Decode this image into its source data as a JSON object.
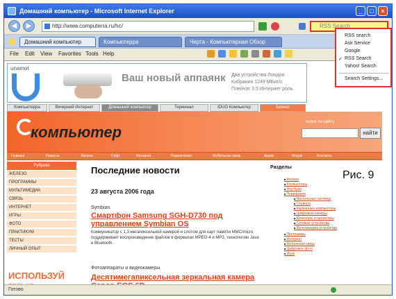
{
  "window": {
    "title": "Домашний компьютер - Microsoft Internet Explorer",
    "min_label": "_",
    "max_label": "□",
    "close_label": "×"
  },
  "address_bar": {
    "url": "http://www.computerra.ru/hc/",
    "search_placeholder": "RSS Search"
  },
  "tabs": [
    {
      "label": "Домашний компьютер"
    },
    {
      "label": "Компьютерра"
    },
    {
      "label": "Черта - Компьютерная Обзор"
    }
  ],
  "menu": [
    "File",
    "Edit",
    "View",
    "Favorites",
    "Tools",
    "Help"
  ],
  "search_dropdown": {
    "items": [
      "RSS search",
      "Ask Service",
      "Google",
      "RSS Search",
      "Yahoo! Search"
    ],
    "selected_index": 3,
    "footer": "Search Settings..."
  },
  "ad": {
    "logo": "unamot",
    "slogan": "Ваш новый аппаянк",
    "small_text": "Два устройства Лондон Кибрания 1249 МБит/с Плейчэт 3.5 Интернет роль"
  },
  "site_tabs": [
    "Компьютерра",
    "Вечерний Интернет",
    "Домашний компьютер",
    "Терминал",
    "IDUG Компьютер",
    "Бизнес"
  ],
  "site": {
    "brand": "компьютер",
    "search_hint": "поиск по сайту",
    "search_button": "найти",
    "nav": [
      "Главная",
      "Новости",
      "Железо",
      "Софт",
      "Интернет",
      "Развлечения",
      "Мобильная связь",
      "Архив",
      "Форум",
      "Контакты"
    ],
    "left_header": "Рубрики",
    "left_items": [
      "ЖЕЛЕЗО",
      "ПРОГРАММЫ",
      "МУЛЬТИМЕДИА",
      "СВЯЗЬ",
      "ИНТЕРНЕТ",
      "ИГРЫ",
      "ФОТО",
      "ПРАКТИКУМ",
      "ТЕСТЫ",
      "ЛИЧНЫЙ ОПЫТ"
    ],
    "promo_line1": "ИСПОЛЬЗУЙ",
    "promo_line2": "ТОЛЬКО",
    "main_heading": "Последние новости",
    "date": "23 августа 2006 года",
    "articles": [
      {
        "category": "Symbian",
        "title": "Смартфон Samsung SGH-D730 под управлением Symbian OS",
        "text": "Коммуникатор с 1,3-мегапиксельной камерой и слотом для карт памяти MMC/micro поддерживает воспроизведение файлов в форматах MPEG-4 и MP3, технологию Java и Bluetooth."
      },
      {
        "category": "Фотоаппараты и видеокамеры",
        "title": "Десятимегапиксельная зеркальная камера Canon EOS 6D",
        "text": ""
      }
    ],
    "right_heading": "Разделы",
    "tree": [
      "Железо",
      "Компьютеры",
      "Ноутбуки",
      "Периферия",
      "Настольные системы",
      "Сервера",
      "Карманные компьютеры",
      "Цифровые камеры",
      "Мониторы и проекторы",
      "Сетевые устройства",
      "Мультимедиа устройства",
      "Программы",
      "Интернет",
      "Мобильная связь",
      "Цифровое фото",
      "Игры"
    ]
  },
  "figure_label": "Рис. 9",
  "status_text": "Готово"
}
